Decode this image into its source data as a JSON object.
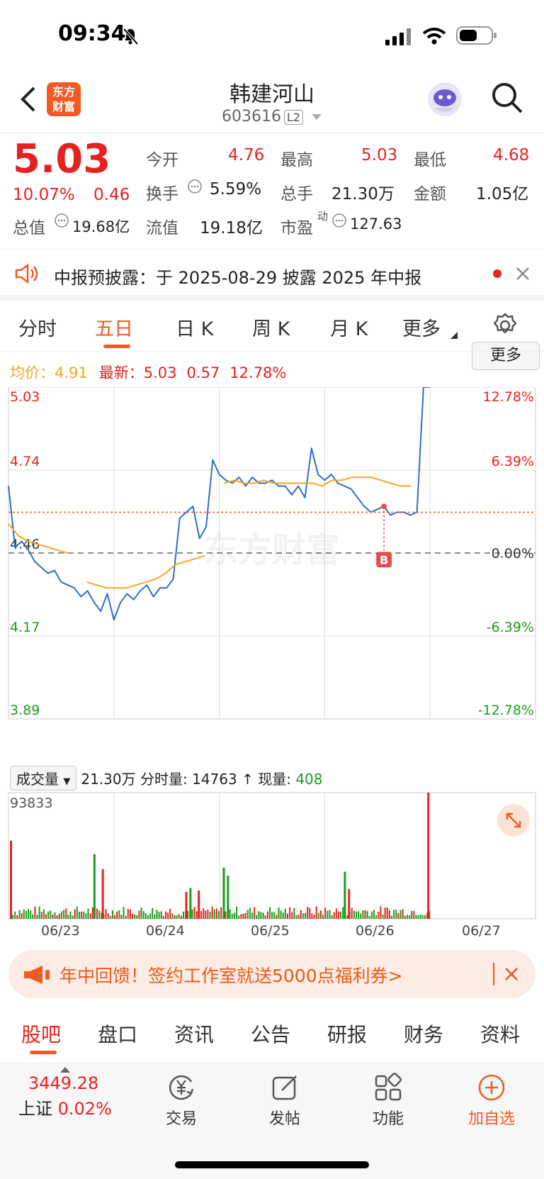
{
  "status_bar": {
    "time": "09:34"
  },
  "header": {
    "logo_text": "东方财富",
    "stock_name": "韩建河山",
    "stock_code": "603616",
    "level_badge": "L2"
  },
  "quote": {
    "price": "5.03",
    "change_pct": "10.07%",
    "change_amt": "0.46",
    "open_label": "今开",
    "open": "4.76",
    "high_label": "最高",
    "high": "5.03",
    "low_label": "最低",
    "low": "4.68",
    "turnover_label": "换手",
    "turnover": "5.59%",
    "volume_label": "总手",
    "volume": "21.30万",
    "amount_label": "金额",
    "amount": "1.05亿",
    "mktcap_label": "总值",
    "mktcap": "19.68亿",
    "float_label": "流值",
    "float_cap": "19.18亿",
    "pe_label": "市盈",
    "pe_sup": "动",
    "pe": "127.63",
    "more_button": "更多"
  },
  "notice": {
    "text": "中报预披露：于 2025-08-29 披露 2025 年中报"
  },
  "chart_tabs": [
    "分时",
    "五日",
    "日 K",
    "周 K",
    "月 K",
    "更多"
  ],
  "chart_tabs_active": 1,
  "legend": {
    "avg_label": "均价：",
    "avg_value": "4.91",
    "latest_label": "最新：",
    "latest_value": "5.03",
    "latest_chg": "0.57",
    "latest_pct": "12.78%"
  },
  "watermark": "东方财富",
  "marker_label": "B",
  "chart_data": {
    "type": "line",
    "title": "",
    "x_categories": [
      "06/23",
      "06/24",
      "06/25",
      "06/26",
      "06/27"
    ],
    "ylim": [
      3.89,
      5.03
    ],
    "prev_close": 4.46,
    "y_ticks_left": [
      "5.03",
      "4.74",
      "4.46",
      "4.17",
      "3.89"
    ],
    "y_ticks_right": [
      "12.78%",
      "6.39%",
      "0.00%",
      "-6.39%",
      "-12.78%"
    ],
    "series": [
      {
        "name": "",
        "color": "#2f6fc0",
        "values": [
          4.69,
          4.48,
          4.5,
          4.47,
          4.43,
          4.41,
          4.39,
          4.4,
          4.36,
          4.35,
          4.34,
          4.31,
          4.33,
          4.29,
          4.26,
          4.32,
          4.23,
          4.29,
          4.32,
          4.3,
          4.33,
          4.35,
          4.31,
          4.34,
          4.34,
          4.37,
          4.58,
          4.6,
          4.62,
          4.51,
          4.55,
          4.78,
          4.73,
          4.71,
          4.7,
          4.72,
          4.69,
          4.72,
          4.7,
          4.7,
          4.71,
          4.69,
          4.69,
          4.66,
          4.69,
          4.65,
          4.82,
          4.73,
          4.71,
          4.73,
          4.7,
          4.69,
          4.68,
          4.65,
          4.62,
          4.6,
          4.61,
          4.62,
          4.59,
          4.6,
          4.6,
          4.59,
          4.6,
          5.03,
          5.03
        ]
      },
      {
        "name": "",
        "color": "#f5a623",
        "values": [
          4.56,
          4.52,
          4.5,
          4.49,
          4.48,
          4.47,
          4.46,
          null,
          4.36,
          4.35,
          4.34,
          4.34,
          4.34,
          4.35,
          4.36,
          4.37,
          4.39,
          4.42,
          4.43,
          4.44,
          4.45,
          null,
          4.7,
          4.71,
          4.7,
          4.7,
          4.71,
          4.7,
          4.7,
          4.7,
          4.7,
          4.7,
          4.69,
          4.71,
          4.71,
          4.72,
          4.72,
          4.72,
          4.71,
          4.7,
          4.69,
          4.69,
          null,
          4.89
        ]
      }
    ],
    "volume": {
      "label": "成交量",
      "total": "21.30万",
      "period_label": "分时量:",
      "period_value": "14763",
      "arrow": "↑",
      "now_label": "现量:",
      "now_value": "408",
      "max_label": "93833",
      "ylim": [
        0,
        93833
      ],
      "spikes": [
        {
          "x": 0.0,
          "value": 58000,
          "color": "#e62221"
        },
        {
          "x": 0.2,
          "value": 48000,
          "color": "#1a9d1a"
        },
        {
          "x": 0.22,
          "value": 37000,
          "color": "#e62221"
        },
        {
          "x": 0.42,
          "value": 20000,
          "color": "#e62221"
        },
        {
          "x": 0.43,
          "value": 23000,
          "color": "#1a9d1a"
        },
        {
          "x": 0.45,
          "value": 21000,
          "color": "#e62221"
        },
        {
          "x": 0.51,
          "value": 38000,
          "color": "#1a9d1a"
        },
        {
          "x": 0.52,
          "value": 32000,
          "color": "#1a9d1a"
        },
        {
          "x": 0.8,
          "value": 35000,
          "color": "#1a9d1a"
        },
        {
          "x": 0.81,
          "value": 22000,
          "color": "#e62221"
        },
        {
          "x": 1.0,
          "value": 93833,
          "color": "#e62221"
        }
      ]
    }
  },
  "promo": {
    "text": "年中回馈！签约工作室就送5000点福利券>"
  },
  "bottom_tabs": [
    "股吧",
    "盘口",
    "资讯",
    "公告",
    "研报",
    "财务",
    "资料"
  ],
  "bottom_tabs_active": 0,
  "toolbar": {
    "index_value": "3449.28",
    "index_name": "上证",
    "index_pct": "0.02%",
    "trade": "交易",
    "post": "发帖",
    "func": "功能",
    "add_watch": "加自选"
  },
  "colors": {
    "up": "#e62221",
    "down": "#1a9d1a",
    "accent": "#f25a24",
    "price_line": "#2f6fc0",
    "avg_line": "#f5a623"
  }
}
